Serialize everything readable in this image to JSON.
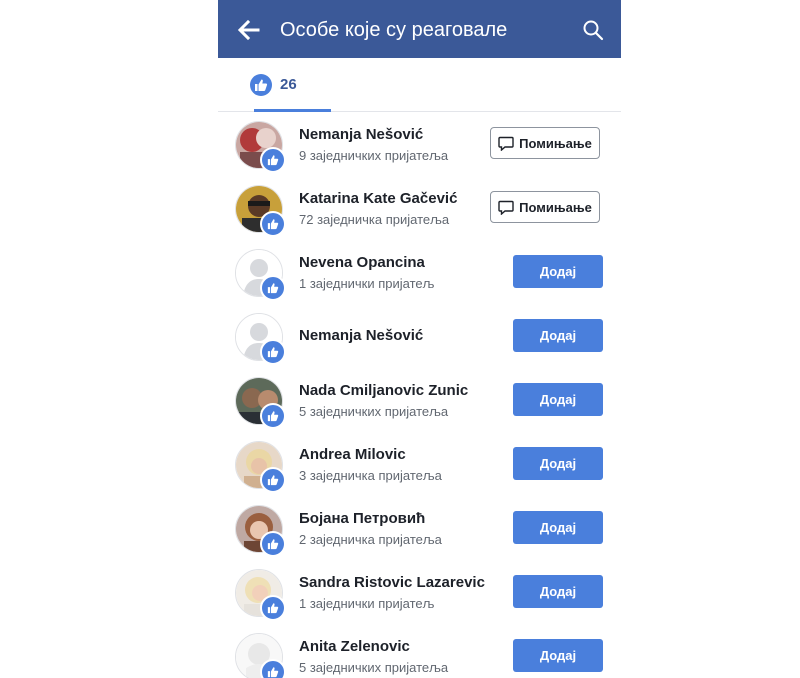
{
  "header": {
    "title": "Особе које су реаговале",
    "back_icon": "arrow-left-icon",
    "search_icon": "search-icon",
    "background_color": "#3b5998"
  },
  "tabs": {
    "like_icon": "like-icon",
    "like_count": "26",
    "accent_color": "#4a7fdc"
  },
  "people": [
    {
      "name": "Nemanja Nešović",
      "mutual": "9 заједничких пријатеља",
      "action": "mention",
      "action_label": "Помињање",
      "avatar": "photo"
    },
    {
      "name": "Katarina Kate Gačević",
      "mutual": "72 заједничка пријатеља",
      "action": "mention",
      "action_label": "Помињање",
      "avatar": "photo"
    },
    {
      "name": "Nevena Opancina",
      "mutual": "1 заједнички пријатељ",
      "action": "add",
      "action_label": "Додај",
      "avatar": "default"
    },
    {
      "name": "Nemanja Nešović",
      "mutual": "",
      "action": "add",
      "action_label": "Додај",
      "avatar": "default"
    },
    {
      "name": "Nada Cmiljanovic Zunic",
      "mutual": "5 заједничких пријатеља",
      "action": "add",
      "action_label": "Додај",
      "avatar": "photo"
    },
    {
      "name": "Andrea Milovic",
      "mutual": "3 заједничка пријатеља",
      "action": "add",
      "action_label": "Додај",
      "avatar": "photo"
    },
    {
      "name": "Бојана Петровић",
      "mutual": "2 заједничка пријатеља",
      "action": "add",
      "action_label": "Додај",
      "avatar": "photo"
    },
    {
      "name": "Sandra Ristovic Lazarevic",
      "mutual": "1 заједнички пријатељ",
      "action": "add",
      "action_label": "Додај",
      "avatar": "photo"
    },
    {
      "name": "Anita Zelenovic",
      "mutual": "5 заједничких пријатеља",
      "action": "add",
      "action_label": "Додај",
      "avatar": "photo"
    }
  ]
}
